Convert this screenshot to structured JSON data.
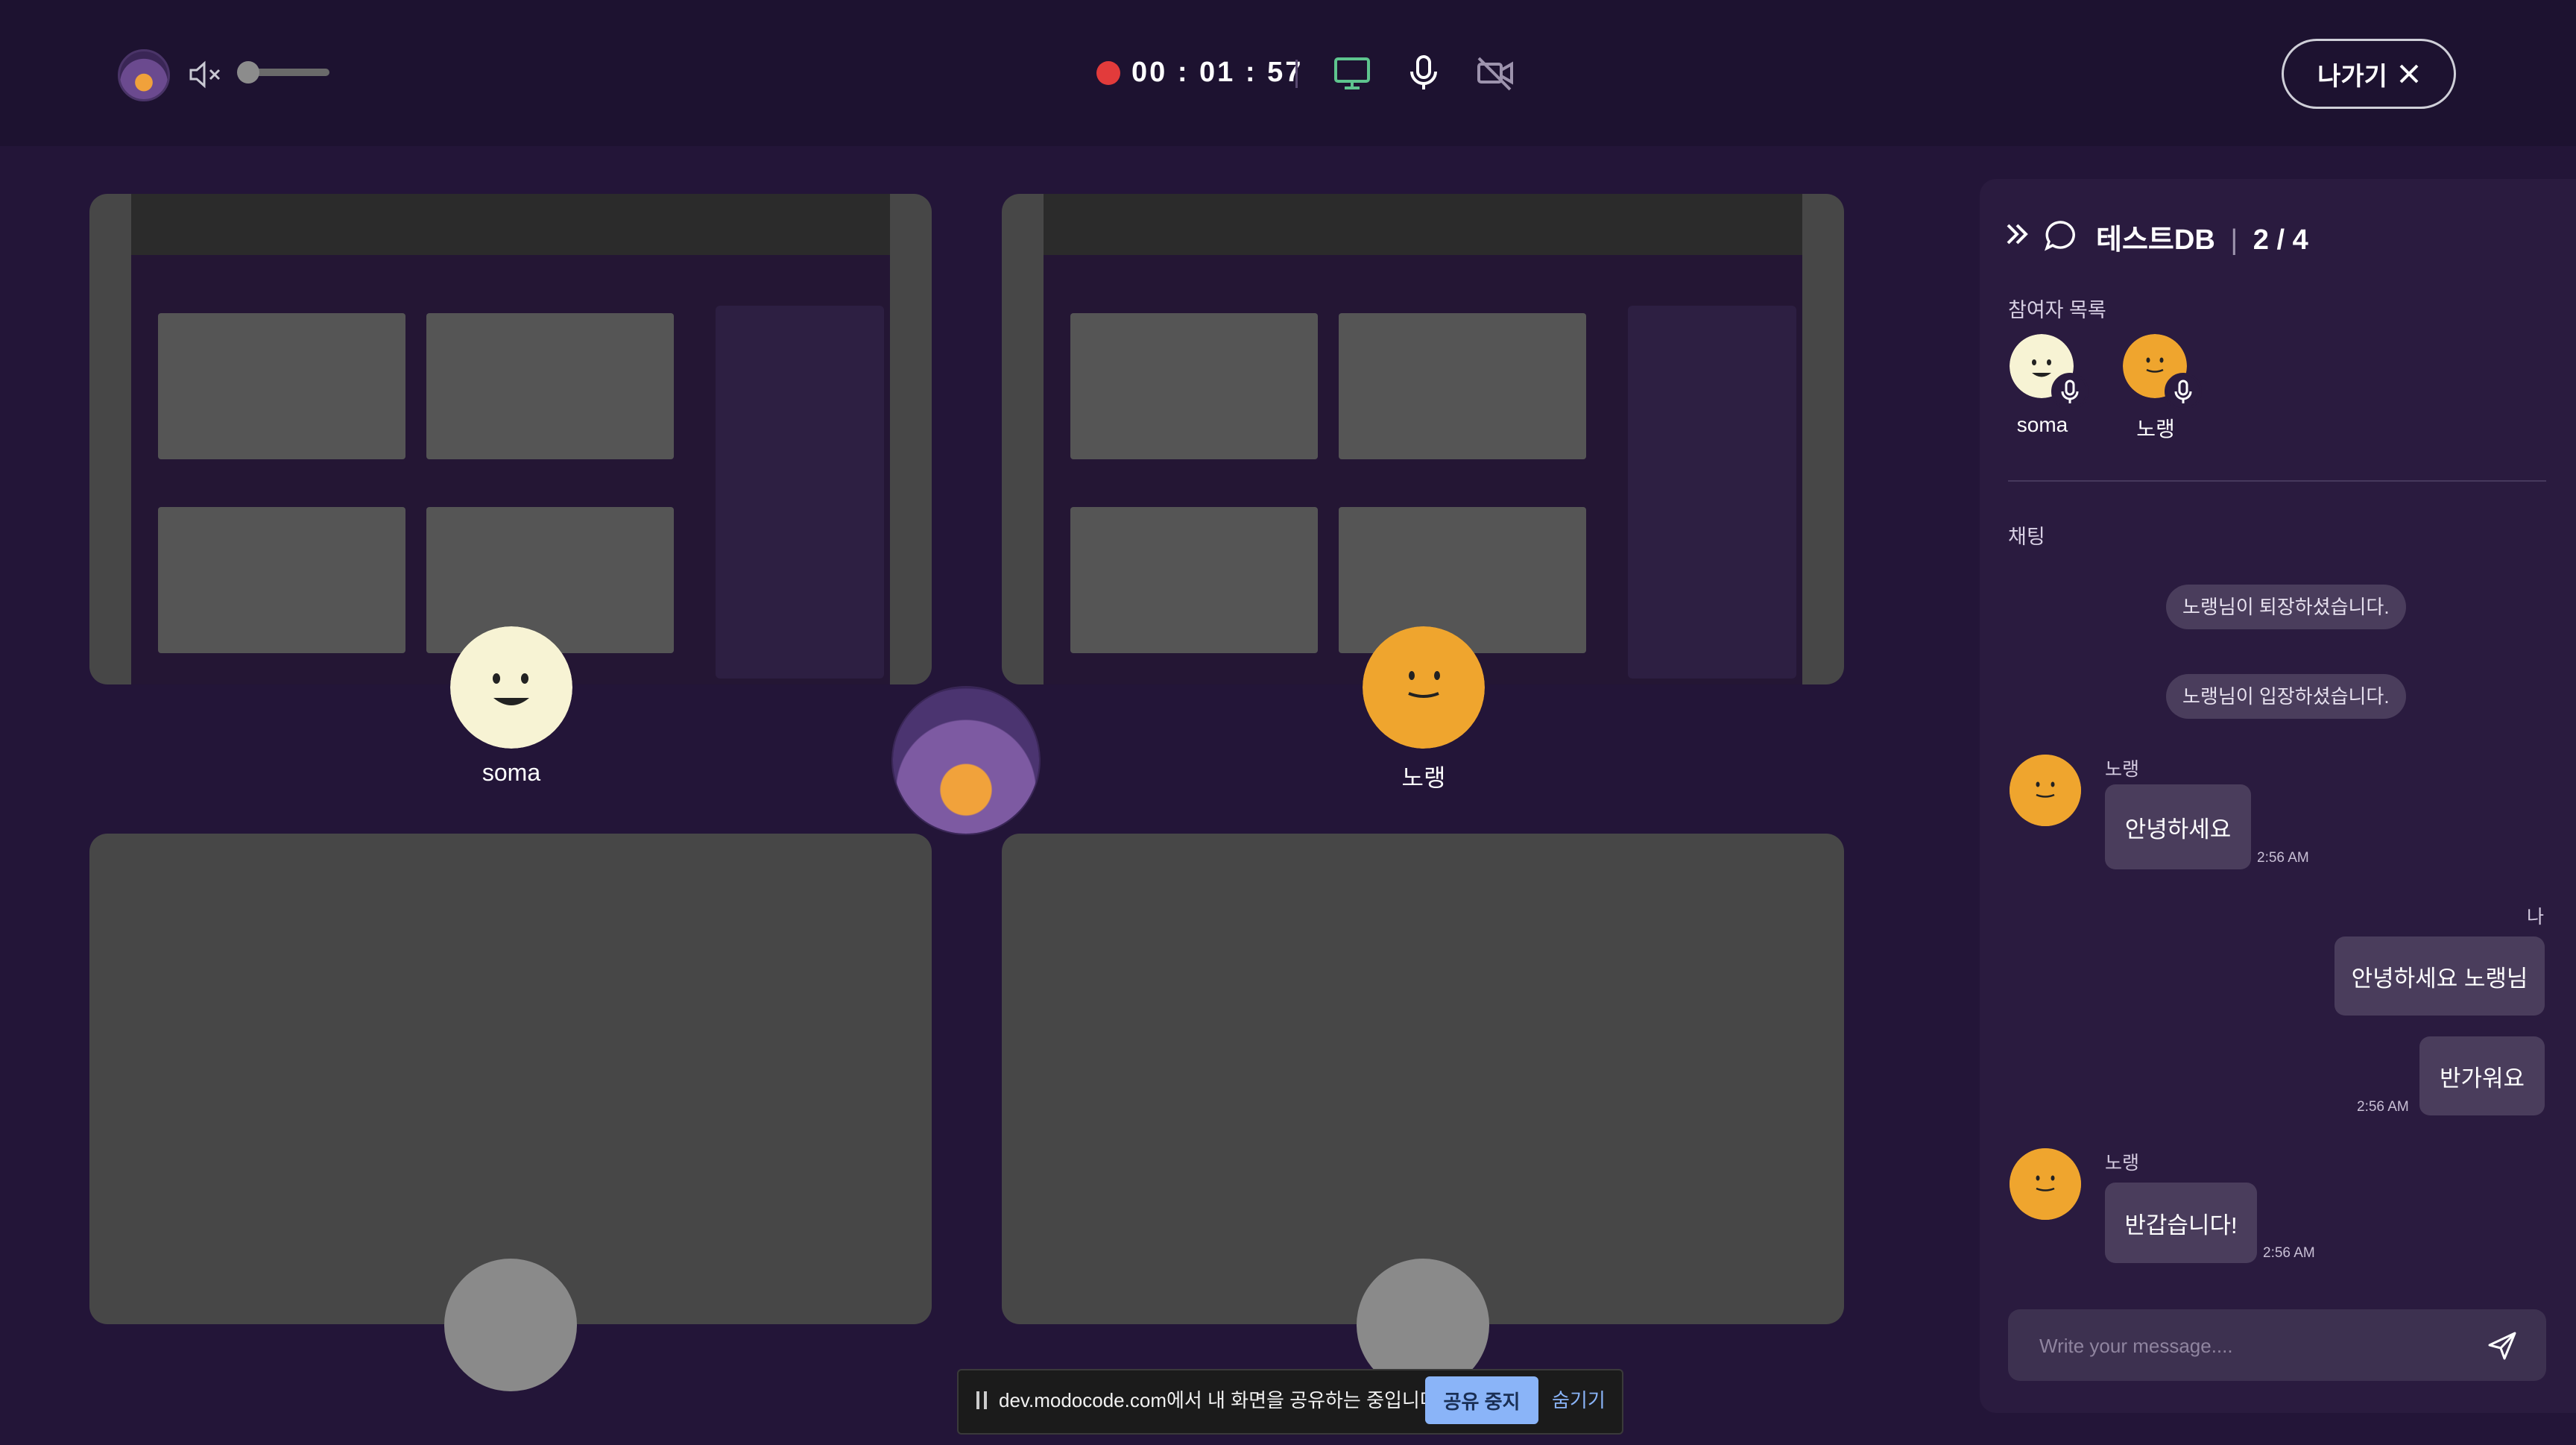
{
  "header": {
    "timer": "00 : 01 : 57",
    "exit_label": "나가기",
    "volume_level": 0.05
  },
  "tiles": {
    "soma_name": "soma",
    "noraeng_name": "노랭"
  },
  "sidebar": {
    "room_name": "테스트DB",
    "room_count": "2 / 4",
    "participants_label": "참여자 목록",
    "participants": [
      {
        "name": "soma"
      },
      {
        "name": "노랭"
      }
    ],
    "chat_label": "채팅",
    "system_messages": [
      "노랭님이 퇴장하셨습니다.",
      "노랭님이 입장하셨습니다."
    ],
    "messages": [
      {
        "sender": "노랭",
        "text": "안녕하세요",
        "time": "2:56 AM"
      },
      {
        "sender": "나",
        "text": "안녕하세요 노랭님",
        "time": ""
      },
      {
        "sender": "",
        "text": "반가워요",
        "time": "2:56 AM"
      },
      {
        "sender": "노랭",
        "text": "반갑습니다!",
        "time": "2:56 AM"
      }
    ],
    "input_placeholder": "Write your message...."
  },
  "share_bar": {
    "message": "dev.modocode.com에서 내 화면을 공유하는 중입니다.",
    "stop_label": "공유 중지",
    "hide_label": "숨기기"
  },
  "colors": {
    "background": "#231538",
    "accent_green": "#5ec48e",
    "record_red": "#e23b3b",
    "avatar_yellow": "#efa52e",
    "avatar_cream": "#f7f3d4"
  }
}
